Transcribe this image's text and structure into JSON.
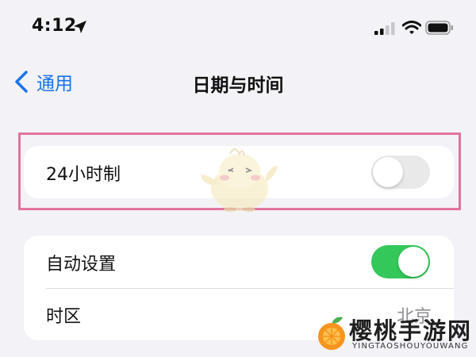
{
  "status_bar": {
    "time": "4:12",
    "icons": [
      "location-arrow-icon",
      "cellular-signal-icon",
      "wifi-icon",
      "battery-icon"
    ]
  },
  "nav": {
    "back_label": "通用",
    "title": "日期与时间"
  },
  "settings": {
    "hour24": {
      "label": "24小时制",
      "on": false
    },
    "auto_set": {
      "label": "自动设置",
      "on": true
    },
    "timezone": {
      "label": "时区",
      "value": "北京"
    }
  },
  "watermark": {
    "name": "樱桃手游网",
    "pinyin": "YINGTAOSHOUYOUWANG"
  },
  "colors": {
    "accent": "#1a73e8",
    "toggle_on": "#34c759",
    "toggle_off": "#e9e9ea",
    "highlight": "#e2739b",
    "background": "#f2f2f7"
  }
}
